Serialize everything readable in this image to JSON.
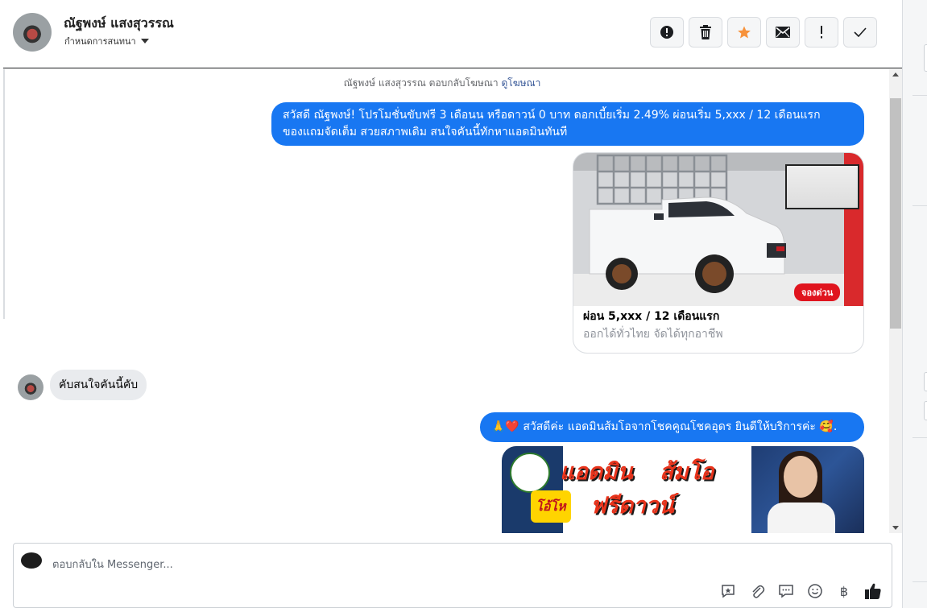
{
  "header": {
    "contact_name": "ณัฐพงษ์ แสงสุวรรณ",
    "assign_label": "กำหนดการสนทนา",
    "actions": [
      {
        "name": "mark-spam-button",
        "icon": "alert-circle-icon"
      },
      {
        "name": "delete-button",
        "icon": "trash-icon"
      },
      {
        "name": "star-button",
        "icon": "star-icon"
      },
      {
        "name": "mark-unread-button",
        "icon": "envelope-icon"
      },
      {
        "name": "flag-button",
        "icon": "exclamation-icon"
      },
      {
        "name": "mark-done-button",
        "icon": "checkmark-icon"
      }
    ]
  },
  "conversation": {
    "notice_text": "ณัฐพงษ์ แสงสุวรรณ ตอบกลับโฆษณา",
    "notice_link": "ดูโฆษณา",
    "message1_line1": "สวัสดี ณัฐพงษ์! โปรโมชั่นขับฟรี 3 เดือนน หรือดาวน์ 0 บาท ดอกเบี้ยเริ่ม 2.49% ผ่อนเริ่ม 5,xxx / 12 เดือนแรก",
    "message1_line2": "ของแถมจัดเต็ม สวยสภาพเดิม สนใจคันนี้ทักหาแอดมินทันที",
    "card": {
      "title": "ผ่อน 5,xxx / 12 เดือนแรก",
      "subtitle": "ออกได้ทั่วไทย จัดได้ทุกอาชีพ",
      "badge": "จองด่วน"
    },
    "incoming_message": "คับสนใจคันนี้คับ",
    "message2": "สวัสดีค่ะ แอดมินส้มโอจากโชคคูณโชคอุดร ยินดีให้บริการค่ะ",
    "message2_emoji_start": "🙏❤️",
    "message2_emoji_end": "🥰.",
    "banner": {
      "title_top": "แอดมิน",
      "title_right": "ส้มโอ",
      "burst": "โอ้โห",
      "headline": "ฟรีดาวน์"
    }
  },
  "composer": {
    "placeholder": "ตอบกลับใน Messenger...",
    "tools": [
      "saved-reply-icon",
      "attachment-icon",
      "chat-icon",
      "emoji-icon",
      "baht-icon",
      "thumbs-up-icon"
    ],
    "baht_symbol": "฿"
  },
  "colors": {
    "accent": "#1877f2",
    "star": "#f7923b",
    "incoming_bubble": "#e9ebee"
  }
}
